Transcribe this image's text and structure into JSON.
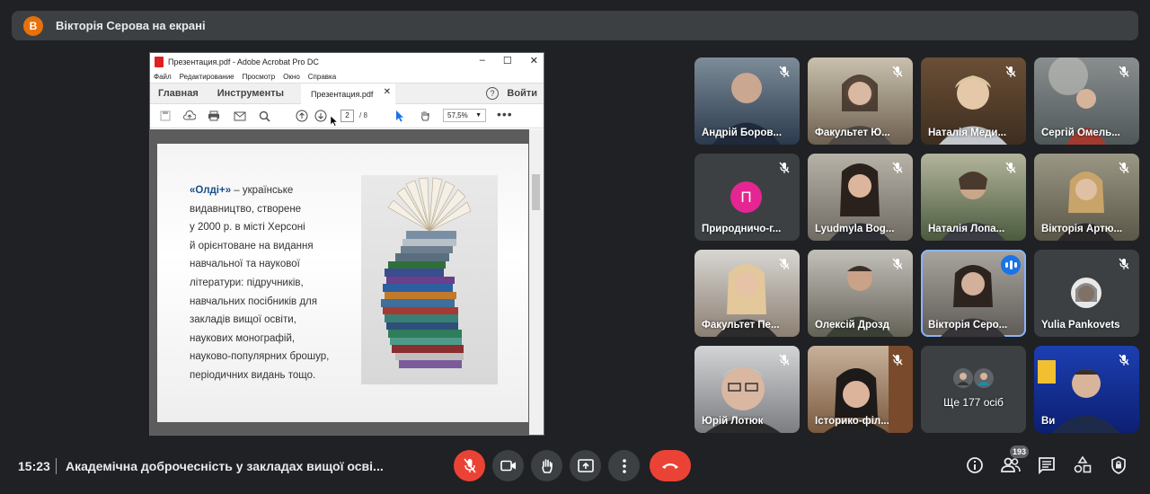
{
  "presenter_banner": {
    "avatar_letter": "В",
    "text": "Вікторія Серова на екрані"
  },
  "acrobat": {
    "window_title": "Презентация.pdf - Adobe Acrobat Pro DC",
    "menu": [
      "Файл",
      "Редактирование",
      "Просмотр",
      "Окно",
      "Справка"
    ],
    "tabs": {
      "home": "Главная",
      "tools": "Инструменты",
      "file_tab": "Презентация.pdf",
      "login": "Войти"
    },
    "page_current": "2",
    "page_total": "/ 8",
    "zoom": "57,5%"
  },
  "slide": {
    "brand": "«Олді+»",
    "lines": [
      " – українське",
      "видавництво, створене",
      "у 2000 р. в місті Херсоні",
      "й орієнтоване на видання",
      "навчальної та наукової",
      "літератури: підручників,",
      "навчальних посібників для",
      "закладів вищої освіти,",
      "наукових монографій,",
      "науково-популярних брошур,",
      "періодичних видань тощо."
    ]
  },
  "participants": [
    {
      "name": "Андрій Боров...",
      "muted": true,
      "letter": ""
    },
    {
      "name": "Факультет Ю...",
      "muted": true,
      "letter": ""
    },
    {
      "name": "Наталія Меди...",
      "muted": true,
      "letter": ""
    },
    {
      "name": "Сергій Омель...",
      "muted": true,
      "letter": ""
    },
    {
      "name": "Природничо-г...",
      "muted": true,
      "letter": "П"
    },
    {
      "name": "Lyudmyla Bog...",
      "muted": true,
      "letter": ""
    },
    {
      "name": "Наталія Лопа...",
      "muted": true,
      "letter": ""
    },
    {
      "name": "Вікторія Артю...",
      "muted": true,
      "letter": ""
    },
    {
      "name": "Факультет Пе...",
      "muted": true,
      "letter": ""
    },
    {
      "name": "Олексій Дрозд",
      "muted": true,
      "letter": ""
    },
    {
      "name": "Вікторія Серо...",
      "muted": false,
      "speaking": true,
      "letter": ""
    },
    {
      "name": "Yulia Pankovets",
      "muted": true,
      "letter": ""
    },
    {
      "name": "Юрій Лотюк",
      "muted": true,
      "letter": ""
    },
    {
      "name": "Історико-філ...",
      "muted": true,
      "letter": ""
    },
    {
      "name": "Ще 177 осіб",
      "muted": false,
      "letter": ""
    },
    {
      "name": "Ви",
      "muted": true,
      "letter": ""
    }
  ],
  "bottom": {
    "time": "15:23",
    "meeting_title": "Академічна доброчесність у закладах вищої осві...",
    "participant_count": "193"
  },
  "colors": {
    "accent_red": "#ea4335",
    "accent_blue": "#1a73e8",
    "background": "#202124",
    "tile": "#3c4043"
  }
}
